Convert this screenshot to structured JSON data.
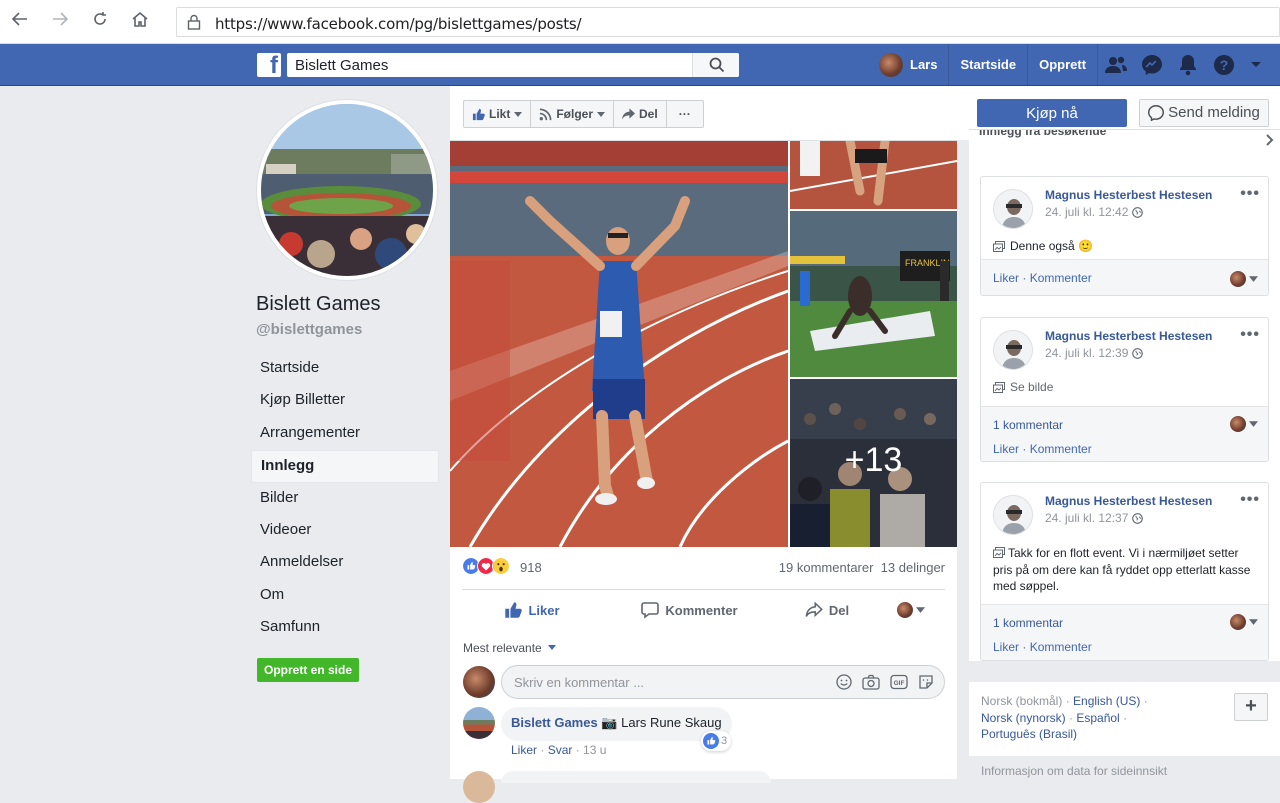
{
  "browser": {
    "url": "https://www.facebook.com/pg/bislettgames/posts/"
  },
  "topbar": {
    "search_value": "Bislett Games",
    "user_name": "Lars",
    "home_label": "Startside",
    "create_label": "Opprett"
  },
  "page": {
    "name": "Bislett Games",
    "handle": "@bislettgames",
    "nav": [
      {
        "label": "Startside"
      },
      {
        "label": "Kjøp Billetter"
      },
      {
        "label": "Arrangementer"
      },
      {
        "label": "Innlegg"
      },
      {
        "label": "Bilder"
      },
      {
        "label": "Videoer"
      },
      {
        "label": "Anmeldelser"
      },
      {
        "label": "Om"
      },
      {
        "label": "Samfunn"
      }
    ],
    "active_nav": "Innlegg",
    "create_page_label": "Opprett en side"
  },
  "action_bar": {
    "liked_label": "Likt",
    "follow_label": "Følger",
    "share_label": "Del",
    "more_label": "···",
    "buy_label": "Kjøp nå",
    "message_label": "Send melding"
  },
  "post": {
    "photo_overflow": "+13",
    "reaction_count": "918",
    "comment_count_label": "19 kommentarer",
    "share_count_label": "13 delinger",
    "like_action": "Liker",
    "comment_action": "Kommenter",
    "share_action": "Del",
    "sort_label": "Mest relevante",
    "comment_placeholder": "Skriv en kommentar ...",
    "comment": {
      "author": "Bislett Games",
      "text": "📷 Lars Rune Skaug",
      "like_label": "Liker",
      "reply_label": "Svar",
      "time": "13 u",
      "like_count": "3"
    }
  },
  "visitor_posts": {
    "header": "Innlegg fra besøkende",
    "items": [
      {
        "author": "Magnus Hesterbest Hestesen",
        "time": "24. juli kl. 12:42",
        "text": "Denne også 🙂",
        "comment_count": "",
        "like_label": "Liker",
        "comment_label": "Kommenter"
      },
      {
        "author": "Magnus Hesterbest Hestesen",
        "time": "24. juli kl. 12:39",
        "text": "Se bilde",
        "comment_count": "1 kommentar",
        "like_label": "Liker",
        "comment_label": "Kommenter"
      },
      {
        "author": "Magnus Hesterbest Hestesen",
        "time": "24. juli kl. 12:37",
        "text": "Takk for en flott event. Vi i nærmiljøet setter pris på om dere kan få ryddet opp etterlatt kasse med søppel.",
        "comment_count": "1 kommentar",
        "like_label": "Liker",
        "comment_label": "Kommenter"
      }
    ]
  },
  "languages": {
    "current": "Norsk (bokmål)",
    "options": [
      "English (US)",
      "Norsk (nynorsk)",
      "Español",
      "Português (Brasil)"
    ],
    "data_info": "Informasjon om data for sideinnsikt"
  },
  "colors": {
    "fb_blue": "#4267b2",
    "link": "#385898",
    "green": "#42b72a",
    "bg": "#e9ebee"
  }
}
